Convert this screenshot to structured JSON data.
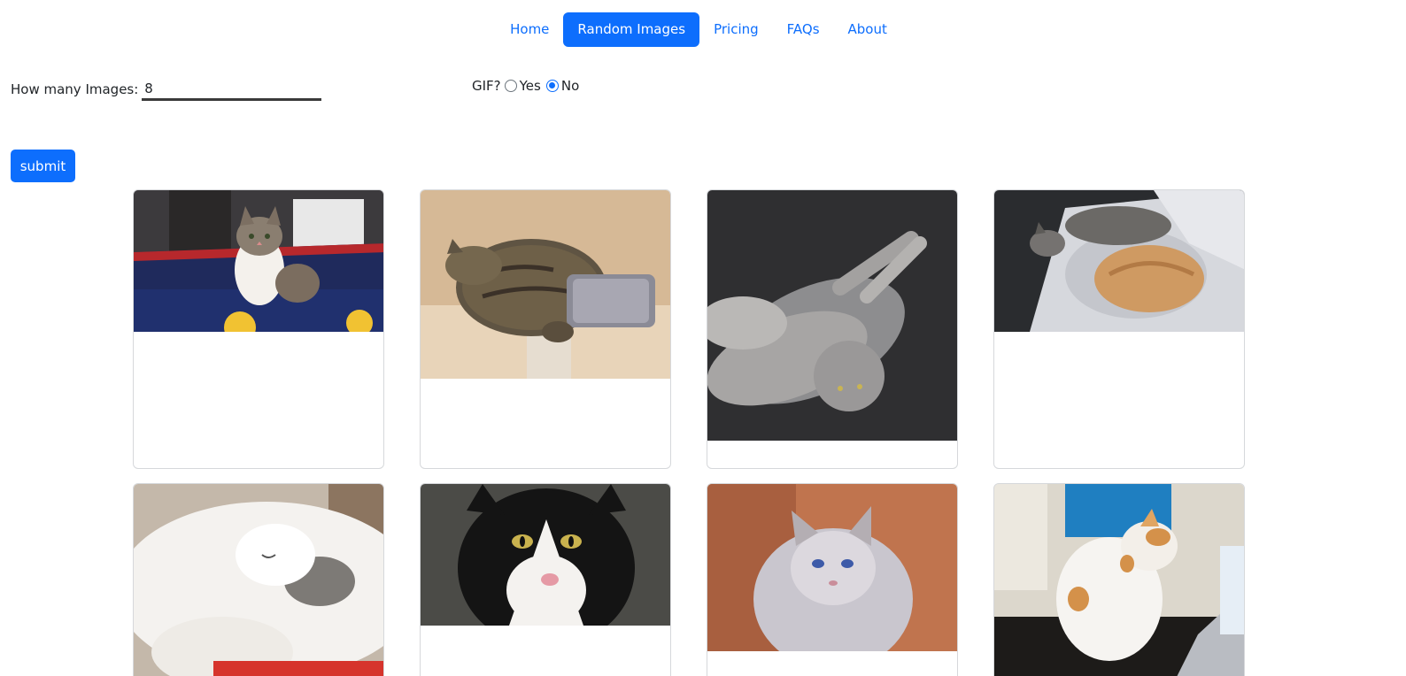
{
  "nav": {
    "items": [
      {
        "label": "Home",
        "active": false
      },
      {
        "label": "Random Images",
        "active": true
      },
      {
        "label": "Pricing",
        "active": false
      },
      {
        "label": "FAQs",
        "active": false
      },
      {
        "label": "About",
        "active": false
      }
    ]
  },
  "form": {
    "count_label": "How many Images:",
    "count_value": "8",
    "gif_label": "GIF?",
    "gif_yes": "Yes",
    "gif_no": "No",
    "gif_selected": "No",
    "submit_label": "submit"
  },
  "gallery": {
    "images": [
      {
        "subject": "tabby-white cat sitting in a storage box"
      },
      {
        "subject": "tabby cat sleeping on cat tree perch"
      },
      {
        "subject": "grey long-haired cat lying on dark carpet"
      },
      {
        "subject": "two cats curled up on white quilted bed"
      },
      {
        "subject": "white cat sleeping on bed"
      },
      {
        "subject": "black and white cat close-up"
      },
      {
        "subject": "fluffy ragdoll cat on orange background"
      },
      {
        "subject": "white and orange cat on desk near laptop"
      }
    ]
  }
}
